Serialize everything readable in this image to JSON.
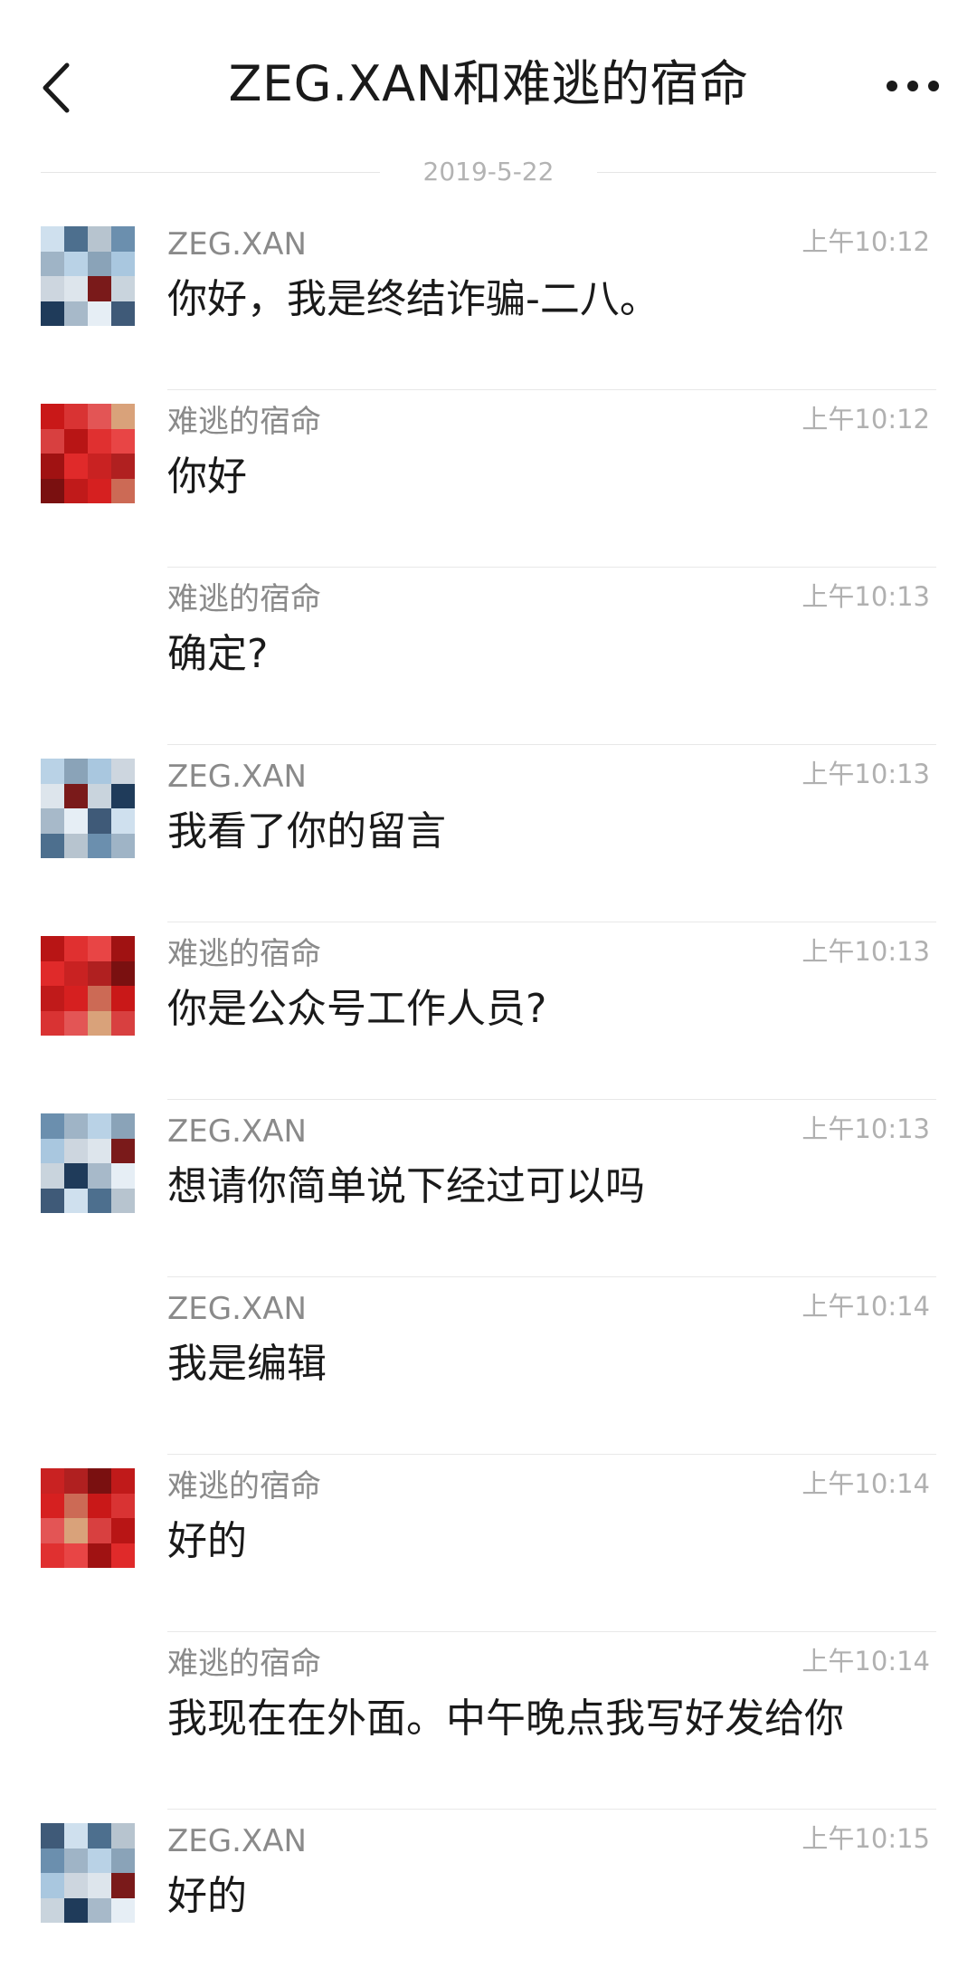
{
  "header": {
    "title": "ZEG.XAN和难逃的宿命",
    "back_icon": "chevron-left-icon",
    "more_icon": "ellipsis-icon"
  },
  "date_separator": "2019-5-22",
  "messages": [
    {
      "sender": "ZEG.XAN",
      "time": "上午10:12",
      "text": "你好，我是终结诈骗-二八。",
      "avatar": "blue"
    },
    {
      "sender": "难逃的宿命",
      "time": "上午10:12",
      "text": "你好",
      "avatar": "red"
    },
    {
      "sender": "难逃的宿命",
      "time": "上午10:13",
      "text": "确定?",
      "avatar": ""
    },
    {
      "sender": "ZEG.XAN",
      "time": "上午10:13",
      "text": "我看了你的留言",
      "avatar": "blue"
    },
    {
      "sender": "难逃的宿命",
      "time": "上午10:13",
      "text": "你是公众号工作人员?",
      "avatar": "red"
    },
    {
      "sender": "ZEG.XAN",
      "time": "上午10:13",
      "text": "想请你简单说下经过可以吗",
      "avatar": "blue"
    },
    {
      "sender": "ZEG.XAN",
      "time": "上午10:14",
      "text": "我是编辑",
      "avatar": ""
    },
    {
      "sender": "难逃的宿命",
      "time": "上午10:14",
      "text": "好的",
      "avatar": "red"
    },
    {
      "sender": "难逃的宿命",
      "time": "上午10:14",
      "text": "我现在在外面。中午晚点我写好发给你",
      "avatar": ""
    },
    {
      "sender": "ZEG.XAN",
      "time": "上午10:15",
      "text": "好的",
      "avatar": "blue"
    }
  ],
  "colors": {
    "text": "#1a1a1a",
    "sender": "#8a8a8a",
    "time": "#b0b0b0",
    "divider": "#e8e8e8"
  }
}
